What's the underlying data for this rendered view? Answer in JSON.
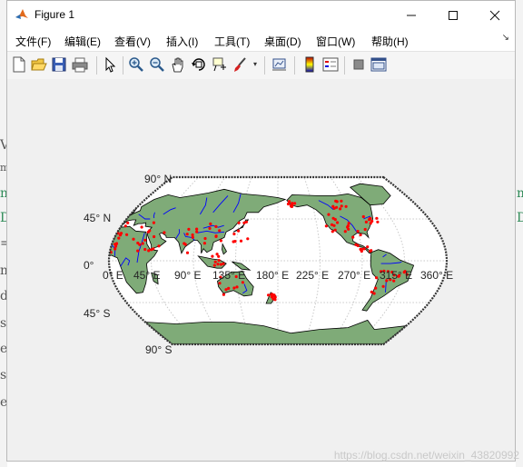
{
  "window": {
    "title": "Figure 1"
  },
  "menu": [
    {
      "label": "文件(F)"
    },
    {
      "label": "编辑(E)"
    },
    {
      "label": "查看(V)"
    },
    {
      "label": "插入(I)"
    },
    {
      "label": "工具(T)"
    },
    {
      "label": "桌面(D)"
    },
    {
      "label": "窗口(W)"
    },
    {
      "label": "帮助(H)"
    }
  ],
  "toolbar_icons": [
    "new-figure-icon",
    "open-file-icon",
    "save-icon",
    "print-icon",
    "pointer-icon",
    "zoom-in-icon",
    "zoom-out-icon",
    "pan-icon",
    "rotate-3d-icon",
    "data-cursor-icon",
    "brush-icon",
    "link-plot-icon",
    "colorbar-icon",
    "legend-icon",
    "hide-plot-tools-icon",
    "show-plot-tools-icon"
  ],
  "map": {
    "lat_labels": [
      "90° N",
      "45° N",
      "0°",
      "45° S",
      "90° S"
    ],
    "lon_labels": [
      "0° E",
      "45° E",
      "90° E",
      "135° E",
      "180° E",
      "225° E",
      "270° E",
      "315° E",
      "360° E"
    ],
    "colors": {
      "land": "#7fab78",
      "coast": "#000000",
      "rivers": "#0000ff",
      "points": "#ff0000"
    }
  },
  "background_chars_left": [
    "V",
    "m",
    "m",
    "D",
    "=",
    "m",
    "d",
    "s",
    "e",
    "s",
    "e"
  ],
  "background_chars_right": [
    "m",
    "D"
  ],
  "watermark": "https://blog.csdn.net/weixin_43820992"
}
